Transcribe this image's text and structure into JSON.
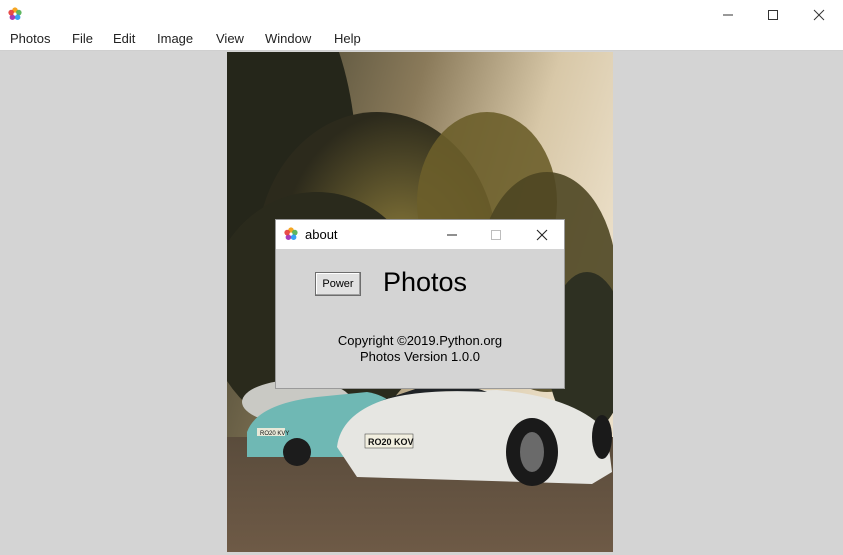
{
  "window": {
    "app_icon": "photos-flower-icon",
    "controls": {
      "minimize": "minimize-icon",
      "maximize": "maximize-icon",
      "close": "close-icon"
    }
  },
  "menu": {
    "items": [
      {
        "label": "Photos"
      },
      {
        "label": "File"
      },
      {
        "label": "Edit"
      },
      {
        "label": "Image"
      },
      {
        "label": "View"
      },
      {
        "label": "Window"
      },
      {
        "label": "Help"
      }
    ]
  },
  "photo": {
    "plates": {
      "front": "RO20 KOV",
      "back": "RO20 KVY"
    }
  },
  "dialog": {
    "title": "about",
    "icon": "photos-flower-icon",
    "power_button": "Power",
    "app_name": "Photos",
    "copyright": "Copyright ©2019.Python.org",
    "version": "Photos Version 1.0.0"
  },
  "colors": {
    "background": "#d4d4d4",
    "titlebar": "#ffffff",
    "dialog_bg": "#d4d4d4"
  }
}
